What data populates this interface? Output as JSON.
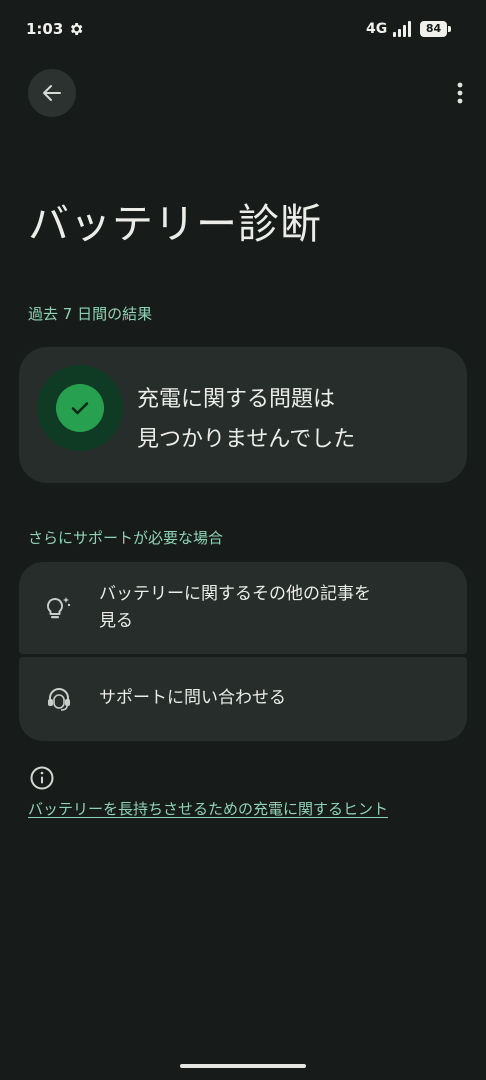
{
  "status_bar": {
    "time": "1:03",
    "network": "4G",
    "battery_level": "84",
    "icons": [
      "gear-icon",
      "signal-icon",
      "battery-icon"
    ]
  },
  "toolbar": {
    "back_icon": "arrow-left-icon",
    "more_icon": "more-vert-icon"
  },
  "page": {
    "title": "バッテリー診断"
  },
  "results": {
    "section_label": "過去 7 日間の結果",
    "card_icon": "check-circle-icon",
    "card_line1": "充電に関する問題は",
    "card_line2": "見つかりませんでした"
  },
  "support": {
    "section_label": "さらにサポートが必要な場合",
    "items": [
      {
        "icon": "lightbulb-icon",
        "line1": "バッテリーに関するその他の記事を",
        "line2": "見る"
      },
      {
        "icon": "headset-icon",
        "line1": "サポートに問い合わせる"
      }
    ]
  },
  "footer": {
    "info_icon": "info-icon",
    "tips_link": "バッテリーを長持ちさせるための充電に関するヒント"
  },
  "colors": {
    "background": "#171c1a",
    "card": "#262d2a",
    "accent": "#8fd3b6",
    "success": "#27a14f",
    "success_halo": "#0f3a23"
  }
}
